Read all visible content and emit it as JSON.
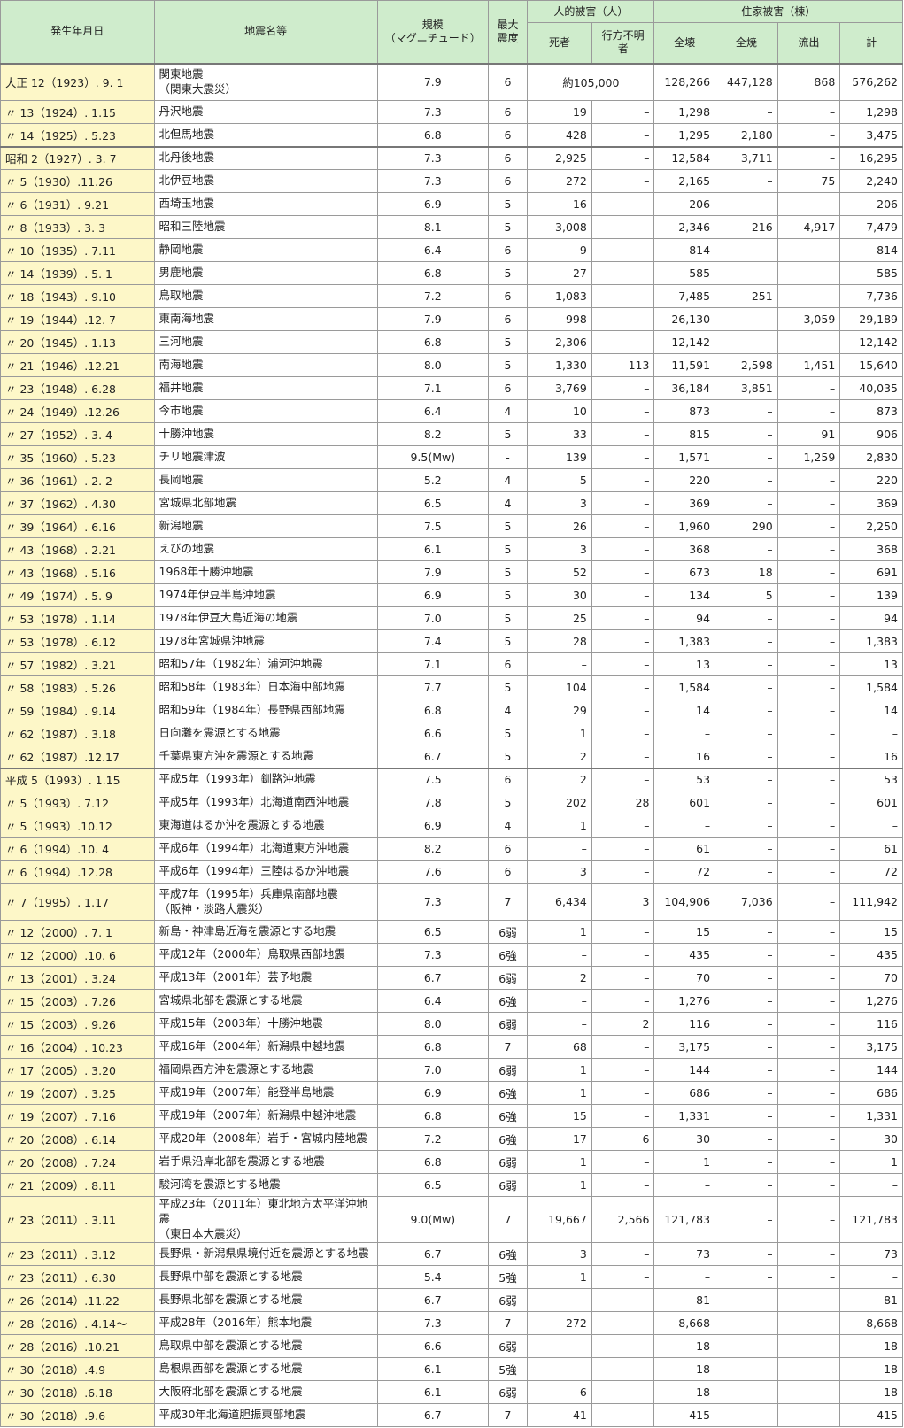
{
  "headers": {
    "date": "発生年月日",
    "name": "地震名等",
    "magnitude": "規模\n（マグニチュード）",
    "intensity": "最大\n震度",
    "human_group": "人的被害（人）",
    "dead": "死者",
    "missing": "行方不明\n者",
    "house_group": "住家被害（棟）",
    "total_collapse": "全壊",
    "total_burn": "全焼",
    "washed": "流出",
    "total": "計"
  },
  "rows": [
    {
      "date": "大正 12（1923）. 9. 1",
      "name": "関東地震\n（関東大震災）",
      "mag": "7.9",
      "int": "6",
      "dead_missing": "約105,000",
      "collapse": "128,266",
      "burn": "447,128",
      "washed": "868",
      "total": "576,262",
      "era": true
    },
    {
      "date": "〃 13（1924）. 1.15",
      "name": "丹沢地震",
      "mag": "7.3",
      "int": "6",
      "dead": "19",
      "missing": "–",
      "collapse": "1,298",
      "burn": "–",
      "washed": "–",
      "total": "1,298"
    },
    {
      "date": "〃 14（1925）. 5.23",
      "name": "北但馬地震",
      "mag": "6.8",
      "int": "6",
      "dead": "428",
      "missing": "–",
      "collapse": "1,295",
      "burn": "2,180",
      "washed": "–",
      "total": "3,475"
    },
    {
      "date": "昭和 2（1927）. 3. 7",
      "name": "北丹後地震",
      "mag": "7.3",
      "int": "6",
      "dead": "2,925",
      "missing": "–",
      "collapse": "12,584",
      "burn": "3,711",
      "washed": "–",
      "total": "16,295",
      "era": true
    },
    {
      "date": "〃 5（1930）.11.26",
      "name": "北伊豆地震",
      "mag": "7.3",
      "int": "6",
      "dead": "272",
      "missing": "–",
      "collapse": "2,165",
      "burn": "–",
      "washed": "75",
      "total": "2,240"
    },
    {
      "date": "〃 6（1931）. 9.21",
      "name": "西埼玉地震",
      "mag": "6.9",
      "int": "5",
      "dead": "16",
      "missing": "–",
      "collapse": "206",
      "burn": "–",
      "washed": "–",
      "total": "206"
    },
    {
      "date": "〃 8（1933）. 3. 3",
      "name": "昭和三陸地震",
      "mag": "8.1",
      "int": "5",
      "dead": "3,008",
      "missing": "–",
      "collapse": "2,346",
      "burn": "216",
      "washed": "4,917",
      "total": "7,479"
    },
    {
      "date": "〃 10（1935）. 7.11",
      "name": "静岡地震",
      "mag": "6.4",
      "int": "6",
      "dead": "9",
      "missing": "–",
      "collapse": "814",
      "burn": "–",
      "washed": "–",
      "total": "814"
    },
    {
      "date": "〃 14（1939）. 5. 1",
      "name": "男鹿地震",
      "mag": "6.8",
      "int": "5",
      "dead": "27",
      "missing": "–",
      "collapse": "585",
      "burn": "–",
      "washed": "–",
      "total": "585"
    },
    {
      "date": "〃 18（1943）. 9.10",
      "name": "鳥取地震",
      "mag": "7.2",
      "int": "6",
      "dead": "1,083",
      "missing": "–",
      "collapse": "7,485",
      "burn": "251",
      "washed": "–",
      "total": "7,736"
    },
    {
      "date": "〃 19（1944）.12. 7",
      "name": "東南海地震",
      "mag": "7.9",
      "int": "6",
      "dead": "998",
      "missing": "–",
      "collapse": "26,130",
      "burn": "–",
      "washed": "3,059",
      "total": "29,189"
    },
    {
      "date": "〃 20（1945）. 1.13",
      "name": "三河地震",
      "mag": "6.8",
      "int": "5",
      "dead": "2,306",
      "missing": "–",
      "collapse": "12,142",
      "burn": "–",
      "washed": "–",
      "total": "12,142"
    },
    {
      "date": "〃 21（1946）.12.21",
      "name": "南海地震",
      "mag": "8.0",
      "int": "5",
      "dead": "1,330",
      "missing": "113",
      "collapse": "11,591",
      "burn": "2,598",
      "washed": "1,451",
      "total": "15,640"
    },
    {
      "date": "〃 23（1948）. 6.28",
      "name": "福井地震",
      "mag": "7.1",
      "int": "6",
      "dead": "3,769",
      "missing": "–",
      "collapse": "36,184",
      "burn": "3,851",
      "washed": "–",
      "total": "40,035"
    },
    {
      "date": "〃 24（1949）.12.26",
      "name": "今市地震",
      "mag": "6.4",
      "int": "4",
      "dead": "10",
      "missing": "–",
      "collapse": "873",
      "burn": "–",
      "washed": "–",
      "total": "873"
    },
    {
      "date": "〃 27（1952）. 3. 4",
      "name": "十勝沖地震",
      "mag": "8.2",
      "int": "5",
      "dead": "33",
      "missing": "–",
      "collapse": "815",
      "burn": "–",
      "washed": "91",
      "total": "906"
    },
    {
      "date": "〃 35（1960）. 5.23",
      "name": "チリ地震津波",
      "mag": "9.5(Mw)",
      "int": "-",
      "dead": "139",
      "missing": "–",
      "collapse": "1,571",
      "burn": "–",
      "washed": "1,259",
      "total": "2,830"
    },
    {
      "date": "〃 36（1961）. 2. 2",
      "name": "長岡地震",
      "mag": "5.2",
      "int": "4",
      "dead": "5",
      "missing": "–",
      "collapse": "220",
      "burn": "–",
      "washed": "–",
      "total": "220"
    },
    {
      "date": "〃 37（1962）. 4.30",
      "name": "宮城県北部地震",
      "mag": "6.5",
      "int": "4",
      "dead": "3",
      "missing": "–",
      "collapse": "369",
      "burn": "–",
      "washed": "–",
      "total": "369"
    },
    {
      "date": "〃 39（1964）. 6.16",
      "name": "新潟地震",
      "mag": "7.5",
      "int": "5",
      "dead": "26",
      "missing": "–",
      "collapse": "1,960",
      "burn": "290",
      "washed": "–",
      "total": "2,250"
    },
    {
      "date": "〃 43（1968）. 2.21",
      "name": "えびの地震",
      "mag": "6.1",
      "int": "5",
      "dead": "3",
      "missing": "–",
      "collapse": "368",
      "burn": "–",
      "washed": "–",
      "total": "368"
    },
    {
      "date": "〃 43（1968）. 5.16",
      "name": "1968年十勝沖地震",
      "mag": "7.9",
      "int": "5",
      "dead": "52",
      "missing": "–",
      "collapse": "673",
      "burn": "18",
      "washed": "–",
      "total": "691"
    },
    {
      "date": "〃 49（1974）. 5. 9",
      "name": "1974年伊豆半島沖地震",
      "mag": "6.9",
      "int": "5",
      "dead": "30",
      "missing": "–",
      "collapse": "134",
      "burn": "5",
      "washed": "–",
      "total": "139"
    },
    {
      "date": "〃 53（1978）. 1.14",
      "name": "1978年伊豆大島近海の地震",
      "mag": "7.0",
      "int": "5",
      "dead": "25",
      "missing": "–",
      "collapse": "94",
      "burn": "–",
      "washed": "–",
      "total": "94"
    },
    {
      "date": "〃 53（1978）. 6.12",
      "name": "1978年宮城県沖地震",
      "mag": "7.4",
      "int": "5",
      "dead": "28",
      "missing": "–",
      "collapse": "1,383",
      "burn": "–",
      "washed": "–",
      "total": "1,383"
    },
    {
      "date": "〃 57（1982）. 3.21",
      "name": "昭和57年（1982年）浦河沖地震",
      "mag": "7.1",
      "int": "6",
      "dead": "–",
      "missing": "–",
      "collapse": "13",
      "burn": "–",
      "washed": "–",
      "total": "13"
    },
    {
      "date": "〃 58（1983）. 5.26",
      "name": "昭和58年（1983年）日本海中部地震",
      "mag": "7.7",
      "int": "5",
      "dead": "104",
      "missing": "–",
      "collapse": "1,584",
      "burn": "–",
      "washed": "–",
      "total": "1,584"
    },
    {
      "date": "〃 59（1984）. 9.14",
      "name": "昭和59年（1984年）長野県西部地震",
      "mag": "6.8",
      "int": "4",
      "dead": "29",
      "missing": "–",
      "collapse": "14",
      "burn": "–",
      "washed": "–",
      "total": "14"
    },
    {
      "date": "〃 62（1987）. 3.18",
      "name": "日向灘を震源とする地震",
      "mag": "6.6",
      "int": "5",
      "dead": "1",
      "missing": "–",
      "collapse": "–",
      "burn": "–",
      "washed": "–",
      "total": "–"
    },
    {
      "date": "〃 62（1987）.12.17",
      "name": "千葉県東方沖を震源とする地震",
      "mag": "6.7",
      "int": "5",
      "dead": "2",
      "missing": "–",
      "collapse": "16",
      "burn": "–",
      "washed": "–",
      "total": "16"
    },
    {
      "date": "平成 5（1993）. 1.15",
      "name": "平成5年（1993年）釧路沖地震",
      "mag": "7.5",
      "int": "6",
      "dead": "2",
      "missing": "–",
      "collapse": "53",
      "burn": "–",
      "washed": "–",
      "total": "53",
      "era": true
    },
    {
      "date": "〃 5（1993）. 7.12",
      "name": "平成5年（1993年）北海道南西沖地震",
      "mag": "7.8",
      "int": "5",
      "dead": "202",
      "missing": "28",
      "collapse": "601",
      "burn": "–",
      "washed": "–",
      "total": "601"
    },
    {
      "date": "〃 5（1993）.10.12",
      "name": "東海道はるか沖を震源とする地震",
      "mag": "6.9",
      "int": "4",
      "dead": "1",
      "missing": "–",
      "collapse": "–",
      "burn": "–",
      "washed": "–",
      "total": "–"
    },
    {
      "date": "〃 6（1994）.10. 4",
      "name": "平成6年（1994年）北海道東方沖地震",
      "mag": "8.2",
      "int": "6",
      "dead": "–",
      "missing": "–",
      "collapse": "61",
      "burn": "–",
      "washed": "–",
      "total": "61"
    },
    {
      "date": "〃 6（1994）.12.28",
      "name": "平成6年（1994年）三陸はるか沖地震",
      "mag": "7.6",
      "int": "6",
      "dead": "3",
      "missing": "–",
      "collapse": "72",
      "burn": "–",
      "washed": "–",
      "total": "72"
    },
    {
      "date": "〃 7（1995）. 1.17",
      "name": "平成7年（1995年）兵庫県南部地震\n（阪神・淡路大震災）",
      "mag": "7.3",
      "int": "7",
      "dead": "6,434",
      "missing": "3",
      "collapse": "104,906",
      "burn": "7,036",
      "washed": "–",
      "total": "111,942"
    },
    {
      "date": "〃 12（2000）. 7. 1",
      "name": "新島・神津島近海を震源とする地震",
      "mag": "6.5",
      "int": "6弱",
      "dead": "1",
      "missing": "–",
      "collapse": "15",
      "burn": "–",
      "washed": "–",
      "total": "15"
    },
    {
      "date": "〃 12（2000）.10. 6",
      "name": "平成12年（2000年）鳥取県西部地震",
      "mag": "7.3",
      "int": "6強",
      "dead": "–",
      "missing": "–",
      "collapse": "435",
      "burn": "–",
      "washed": "–",
      "total": "435"
    },
    {
      "date": "〃 13（2001）. 3.24",
      "name": "平成13年（2001年）芸予地震",
      "mag": "6.7",
      "int": "6弱",
      "dead": "2",
      "missing": "–",
      "collapse": "70",
      "burn": "–",
      "washed": "–",
      "total": "70"
    },
    {
      "date": "〃 15（2003）. 7.26",
      "name": "宮城県北部を震源とする地震",
      "mag": "6.4",
      "int": "6強",
      "dead": "–",
      "missing": "–",
      "collapse": "1,276",
      "burn": "–",
      "washed": "–",
      "total": "1,276"
    },
    {
      "date": "〃 15（2003）. 9.26",
      "name": "平成15年（2003年）十勝沖地震",
      "mag": "8.0",
      "int": "6弱",
      "dead": "–",
      "missing": "2",
      "collapse": "116",
      "burn": "–",
      "washed": "–",
      "total": "116"
    },
    {
      "date": "〃 16（2004）. 10.23",
      "name": "平成16年（2004年）新潟県中越地震",
      "mag": "6.8",
      "int": "7",
      "dead": "68",
      "missing": "–",
      "collapse": "3,175",
      "burn": "–",
      "washed": "–",
      "total": "3,175"
    },
    {
      "date": "〃 17（2005）. 3.20",
      "name": "福岡県西方沖を震源とする地震",
      "mag": "7.0",
      "int": "6弱",
      "dead": "1",
      "missing": "–",
      "collapse": "144",
      "burn": "–",
      "washed": "–",
      "total": "144"
    },
    {
      "date": "〃 19（2007）. 3.25",
      "name": "平成19年（2007年）能登半島地震",
      "mag": "6.9",
      "int": "6強",
      "dead": "1",
      "missing": "–",
      "collapse": "686",
      "burn": "–",
      "washed": "–",
      "total": "686"
    },
    {
      "date": "〃 19（2007）. 7.16",
      "name": "平成19年（2007年）新潟県中越沖地震",
      "mag": "6.8",
      "int": "6強",
      "dead": "15",
      "missing": "–",
      "collapse": "1,331",
      "burn": "–",
      "washed": "–",
      "total": "1,331"
    },
    {
      "date": "〃 20（2008）. 6.14",
      "name": "平成20年（2008年）岩手・宮城内陸地震",
      "mag": "7.2",
      "int": "6強",
      "dead": "17",
      "missing": "6",
      "collapse": "30",
      "burn": "–",
      "washed": "–",
      "total": "30"
    },
    {
      "date": "〃 20（2008）. 7.24",
      "name": "岩手県沿岸北部を震源とする地震",
      "mag": "6.8",
      "int": "6弱",
      "dead": "1",
      "missing": "–",
      "collapse": "1",
      "burn": "–",
      "washed": "–",
      "total": "1"
    },
    {
      "date": "〃 21（2009）. 8.11",
      "name": "駿河湾を震源とする地震",
      "mag": "6.5",
      "int": "6弱",
      "dead": "1",
      "missing": "–",
      "collapse": "–",
      "burn": "–",
      "washed": "–",
      "total": "–"
    },
    {
      "date": "〃 23（2011）. 3.11",
      "name": "平成23年（2011年）東北地方太平洋沖地震\n（東日本大震災）",
      "mag": "9.0(Mw)",
      "int": "7",
      "dead": "19,667",
      "missing": "2,566",
      "collapse": "121,783",
      "burn": "–",
      "washed": "–",
      "total": "121,783"
    },
    {
      "date": "〃 23（2011）. 3.12",
      "name": "長野県・新潟県県境付近を震源とする地震",
      "mag": "6.7",
      "int": "6強",
      "dead": "3",
      "missing": "–",
      "collapse": "73",
      "burn": "–",
      "washed": "–",
      "total": "73"
    },
    {
      "date": "〃 23（2011）. 6.30",
      "name": "長野県中部を震源とする地震",
      "mag": "5.4",
      "int": "5強",
      "dead": "1",
      "missing": "–",
      "collapse": "–",
      "burn": "–",
      "washed": "–",
      "total": "–"
    },
    {
      "date": "〃 26（2014）.11.22",
      "name": "長野県北部を震源とする地震",
      "mag": "6.7",
      "int": "6弱",
      "dead": "–",
      "missing": "–",
      "collapse": "81",
      "burn": "–",
      "washed": "–",
      "total": "81"
    },
    {
      "date": "〃 28（2016）. 4.14～",
      "name": "平成28年（2016年）熊本地震",
      "mag": "7.3",
      "int": "7",
      "dead": "272",
      "missing": "–",
      "collapse": "8,668",
      "burn": "–",
      "washed": "–",
      "total": "8,668"
    },
    {
      "date": "〃 28（2016）.10.21",
      "name": "鳥取県中部を震源とする地震",
      "mag": "6.6",
      "int": "6弱",
      "dead": "–",
      "missing": "–",
      "collapse": "18",
      "burn": "–",
      "washed": "–",
      "total": "18"
    },
    {
      "date": "〃 30（2018）.4.9",
      "name": "島根県西部を震源とする地震",
      "mag": "6.1",
      "int": "5強",
      "dead": "–",
      "missing": "–",
      "collapse": "18",
      "burn": "–",
      "washed": "–",
      "total": "18"
    },
    {
      "date": "〃 30（2018）.6.18",
      "name": "大阪府北部を震源とする地震",
      "mag": "6.1",
      "int": "6弱",
      "dead": "6",
      "missing": "–",
      "collapse": "18",
      "burn": "–",
      "washed": "–",
      "total": "18"
    },
    {
      "date": "〃 30（2018）.9.6",
      "name": "平成30年北海道胆振東部地震",
      "mag": "6.7",
      "int": "7",
      "dead": "41",
      "missing": "–",
      "collapse": "415",
      "burn": "–",
      "washed": "–",
      "total": "415"
    }
  ]
}
